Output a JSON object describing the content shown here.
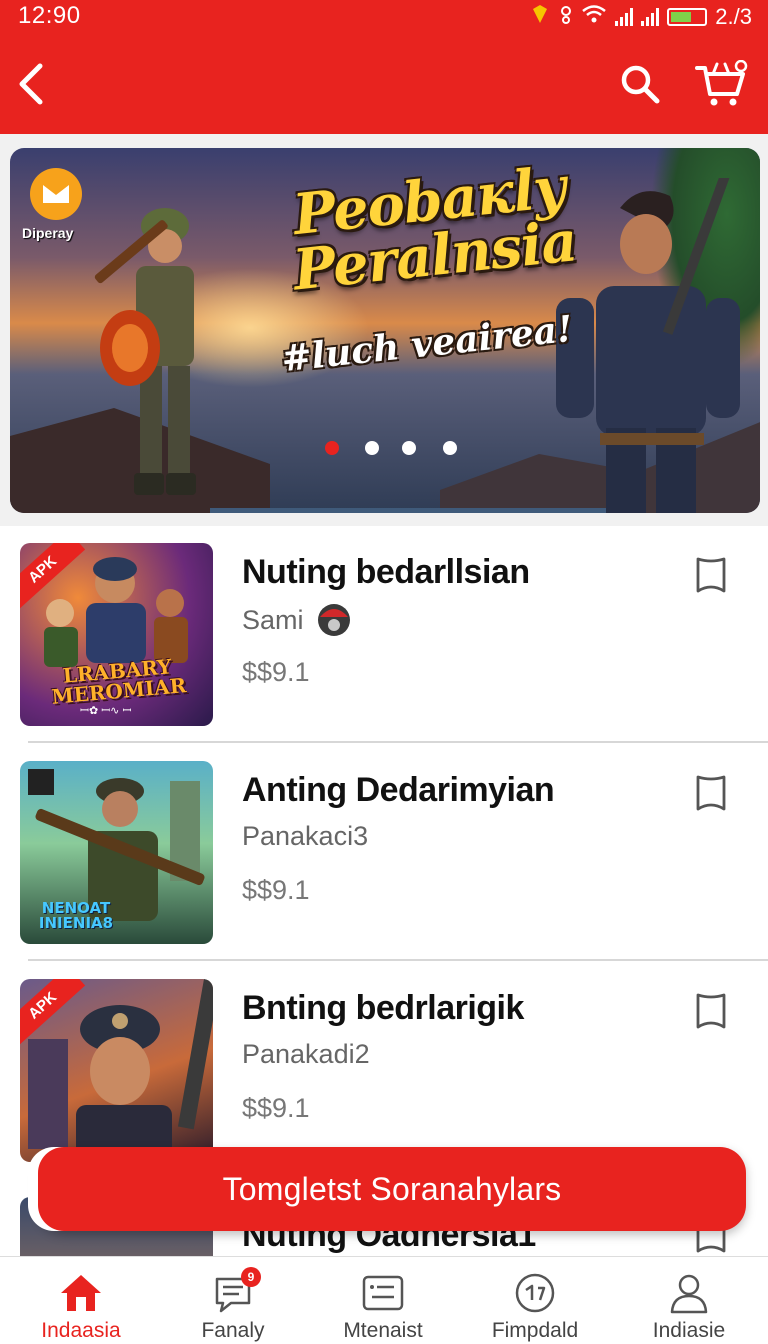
{
  "status_bar": {
    "time": "12:90",
    "battery_text": "2./3"
  },
  "header": {
    "back_icon": "back-arrow-icon",
    "search_icon": "search-icon",
    "cart_icon": "cart-icon"
  },
  "banner": {
    "badge_label": "Diperay",
    "title_line1": "Peobaкly",
    "title_line2": "Peralnsia",
    "tagline": "#luch veairea!",
    "dots": 4,
    "active_dot": 0
  },
  "items": [
    {
      "title": "Nuting bedarllsian",
      "subtitle": "Sami",
      "price": "$$9.1",
      "tag": "APK",
      "thumb_text": "LRABARY MEROMIAR",
      "thumb_small": "ꟷ✿ ꟷ∿ ꟷ"
    },
    {
      "title": "Anting Dedarimyian",
      "subtitle": "Panakaci3",
      "price": "$$9.1",
      "thumb_text": "NENOAT INIENIA8"
    },
    {
      "title": "Bnting bedrlarigik",
      "subtitle": "Panakadi2",
      "price": "$$9.1",
      "tag": "APK"
    },
    {
      "title": "Nuting Oadnersia1"
    }
  ],
  "cta": {
    "label": "Tomgletst Soranahylars"
  },
  "bottom_nav": [
    {
      "label": "Indaasia",
      "icon": "home-icon",
      "active": true
    },
    {
      "label": "Fanaly",
      "icon": "feed-icon",
      "badge": "9"
    },
    {
      "label": "Mtenaist",
      "icon": "list-icon"
    },
    {
      "label": "Fimpdald",
      "icon": "explore-icon"
    },
    {
      "label": "Indiasie",
      "icon": "profile-icon"
    }
  ],
  "colors": {
    "accent": "#e8231f",
    "banner_title": "#ffd43b"
  }
}
